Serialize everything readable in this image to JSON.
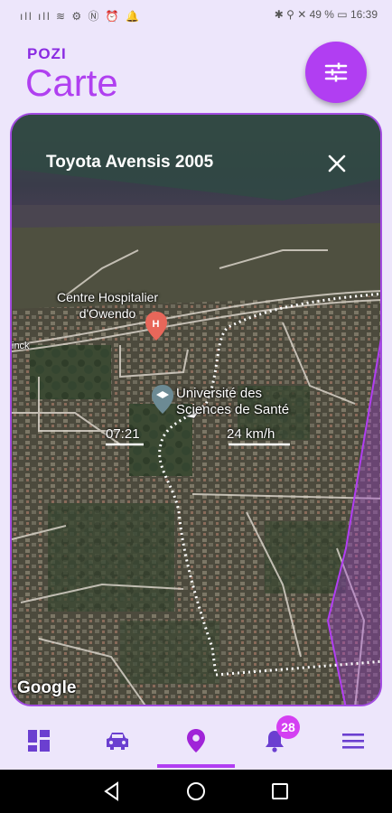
{
  "status_bar": {
    "left_icons": [
      "signal-icon",
      "signal-icon",
      "wifi-icon",
      "settings-icon",
      "nfc-icon",
      "alarm-icon",
      "notification-icon"
    ],
    "right_text": "✱ ⚲ ✕ 49 % ▭ 16:39"
  },
  "header": {
    "brand": "POZI",
    "title": "Carte"
  },
  "map": {
    "vehicle_name": "Toyota Avensis 2005",
    "poi_hospital": "Centre Hospitalier\nd'Owendo",
    "poi_university": "Université des\nSciences de Santé",
    "time_label": "07:21",
    "speed_label": "24 km/h",
    "attribution": "Google",
    "edge_label": "inck"
  },
  "nav": {
    "items": [
      {
        "name": "dashboard",
        "icon": "dashboard-icon"
      },
      {
        "name": "vehicles",
        "icon": "car-icon"
      },
      {
        "name": "map",
        "icon": "location-pin-icon",
        "active": true
      },
      {
        "name": "notifications",
        "icon": "bell-icon"
      },
      {
        "name": "menu",
        "icon": "hamburger-menu-icon"
      }
    ],
    "notification_count": "28"
  },
  "colors": {
    "accent": "#b13ef2",
    "brand": "#8a2be2",
    "nav_icon": "#6b3fd0",
    "background": "#ede6fb"
  }
}
